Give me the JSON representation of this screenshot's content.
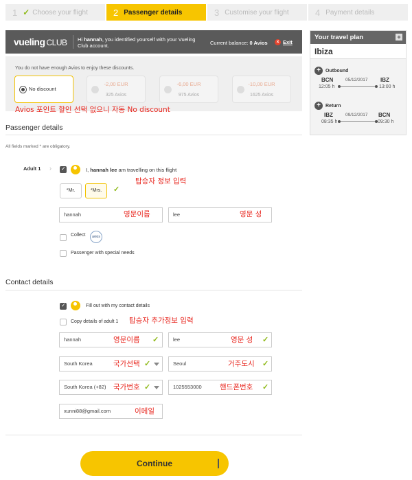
{
  "steps": [
    {
      "num": "1",
      "label": "Choose your flight",
      "done": true
    },
    {
      "num": "2",
      "label": "Passenger details",
      "active": true
    },
    {
      "num": "3",
      "label": "Customise your flight"
    },
    {
      "num": "4",
      "label": "Payment details"
    }
  ],
  "club": {
    "logo": "vueling",
    "logo_sub": "CLUB",
    "message_pre": "Hi ",
    "user": "hannah",
    "message_post": ", you identified yourself with your Vueling Club account.",
    "balance_label": "Current balance: ",
    "balance_value": "0 Avios",
    "exit": "Exit"
  },
  "discounts": {
    "note": "You do not have enough Avios to enjoy these discounts.",
    "options": [
      {
        "label": "No discount"
      },
      {
        "eur": "-2,00 EUR",
        "avios": "325 Avios"
      },
      {
        "eur": "-6,00 EUR",
        "avios": "975 Avios"
      },
      {
        "eur": "-10,00 EUR",
        "avios": "1625 Avios"
      }
    ]
  },
  "annotations": {
    "avios": "Avios 포인트 할인 선택 없으니 자동 No discount",
    "passenger": "탑승자 정보 입력",
    "first_name": "영문이름",
    "last_name": "영문 성",
    "contact": "탑승자 추가정보 입력",
    "c_first": "영문이름",
    "c_last": "영문 성",
    "country": "국가선택",
    "city": "거주도시",
    "code": "국가번호",
    "phone": "핸드폰번호",
    "email": "이메일"
  },
  "passenger": {
    "title": "Passenger details",
    "required_note": "All fields marked * are obligatory.",
    "adult_label": "Adult 1",
    "travelling_pre": "I, ",
    "travelling_name": "hannah lee",
    "travelling_post": " am travelling on this flight",
    "title_mr": "*Mr.",
    "title_mrs": "*Mrs.",
    "first_name": "hannah",
    "last_name": "lee",
    "collect": "Collect",
    "avios_badge": "avios",
    "special_needs": "Passenger with special needs"
  },
  "contact": {
    "title": "Contact details",
    "fill_out": "Fill out with my contact details",
    "copy_adult": "Copy details of adult 1",
    "first_name": "hannah",
    "last_name": "lee",
    "country": "South Korea",
    "city": "Seoul",
    "code": "South Korea (+82)",
    "phone": "1025553000",
    "email": "xunni88@gmail.com"
  },
  "continue_label": "Continue",
  "plan": {
    "title": "Your travel plan",
    "destination": "Ibiza",
    "outbound": {
      "label": "Outbound",
      "from": "BCN",
      "to": "IBZ",
      "date": "05/12/2017",
      "dep": "12:05 h",
      "arr": "13:00 h"
    },
    "return": {
      "label": "Return",
      "from": "IBZ",
      "to": "BCN",
      "date": "09/12/2017",
      "dep": "08:35 h",
      "arr": "09:30 h"
    }
  },
  "colors": {
    "accent": "#f7c500",
    "annotation": "#e8261e",
    "ok": "#8fba1a"
  }
}
